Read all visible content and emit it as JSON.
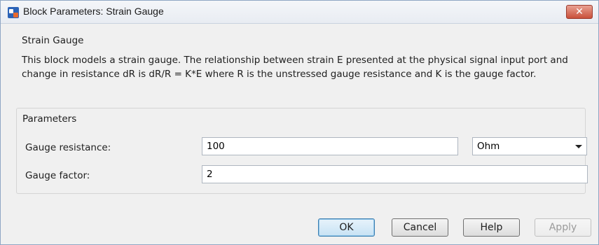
{
  "window": {
    "title": "Block Parameters: Strain Gauge",
    "close_label": "✕"
  },
  "description_group": {
    "title": "Strain Gauge",
    "text": "This block models a strain gauge. The relationship between strain E presented at the physical signal input port and change in resistance dR is dR/R = K*E where R is the unstressed gauge resistance and K is the gauge factor."
  },
  "parameters_group": {
    "title": "Parameters",
    "gauge_resistance": {
      "label": "Gauge resistance:",
      "value": "100",
      "unit": "Ohm"
    },
    "gauge_factor": {
      "label": "Gauge factor:",
      "value": "2"
    }
  },
  "buttons": {
    "ok": "OK",
    "cancel": "Cancel",
    "help": "Help",
    "apply": "Apply"
  }
}
